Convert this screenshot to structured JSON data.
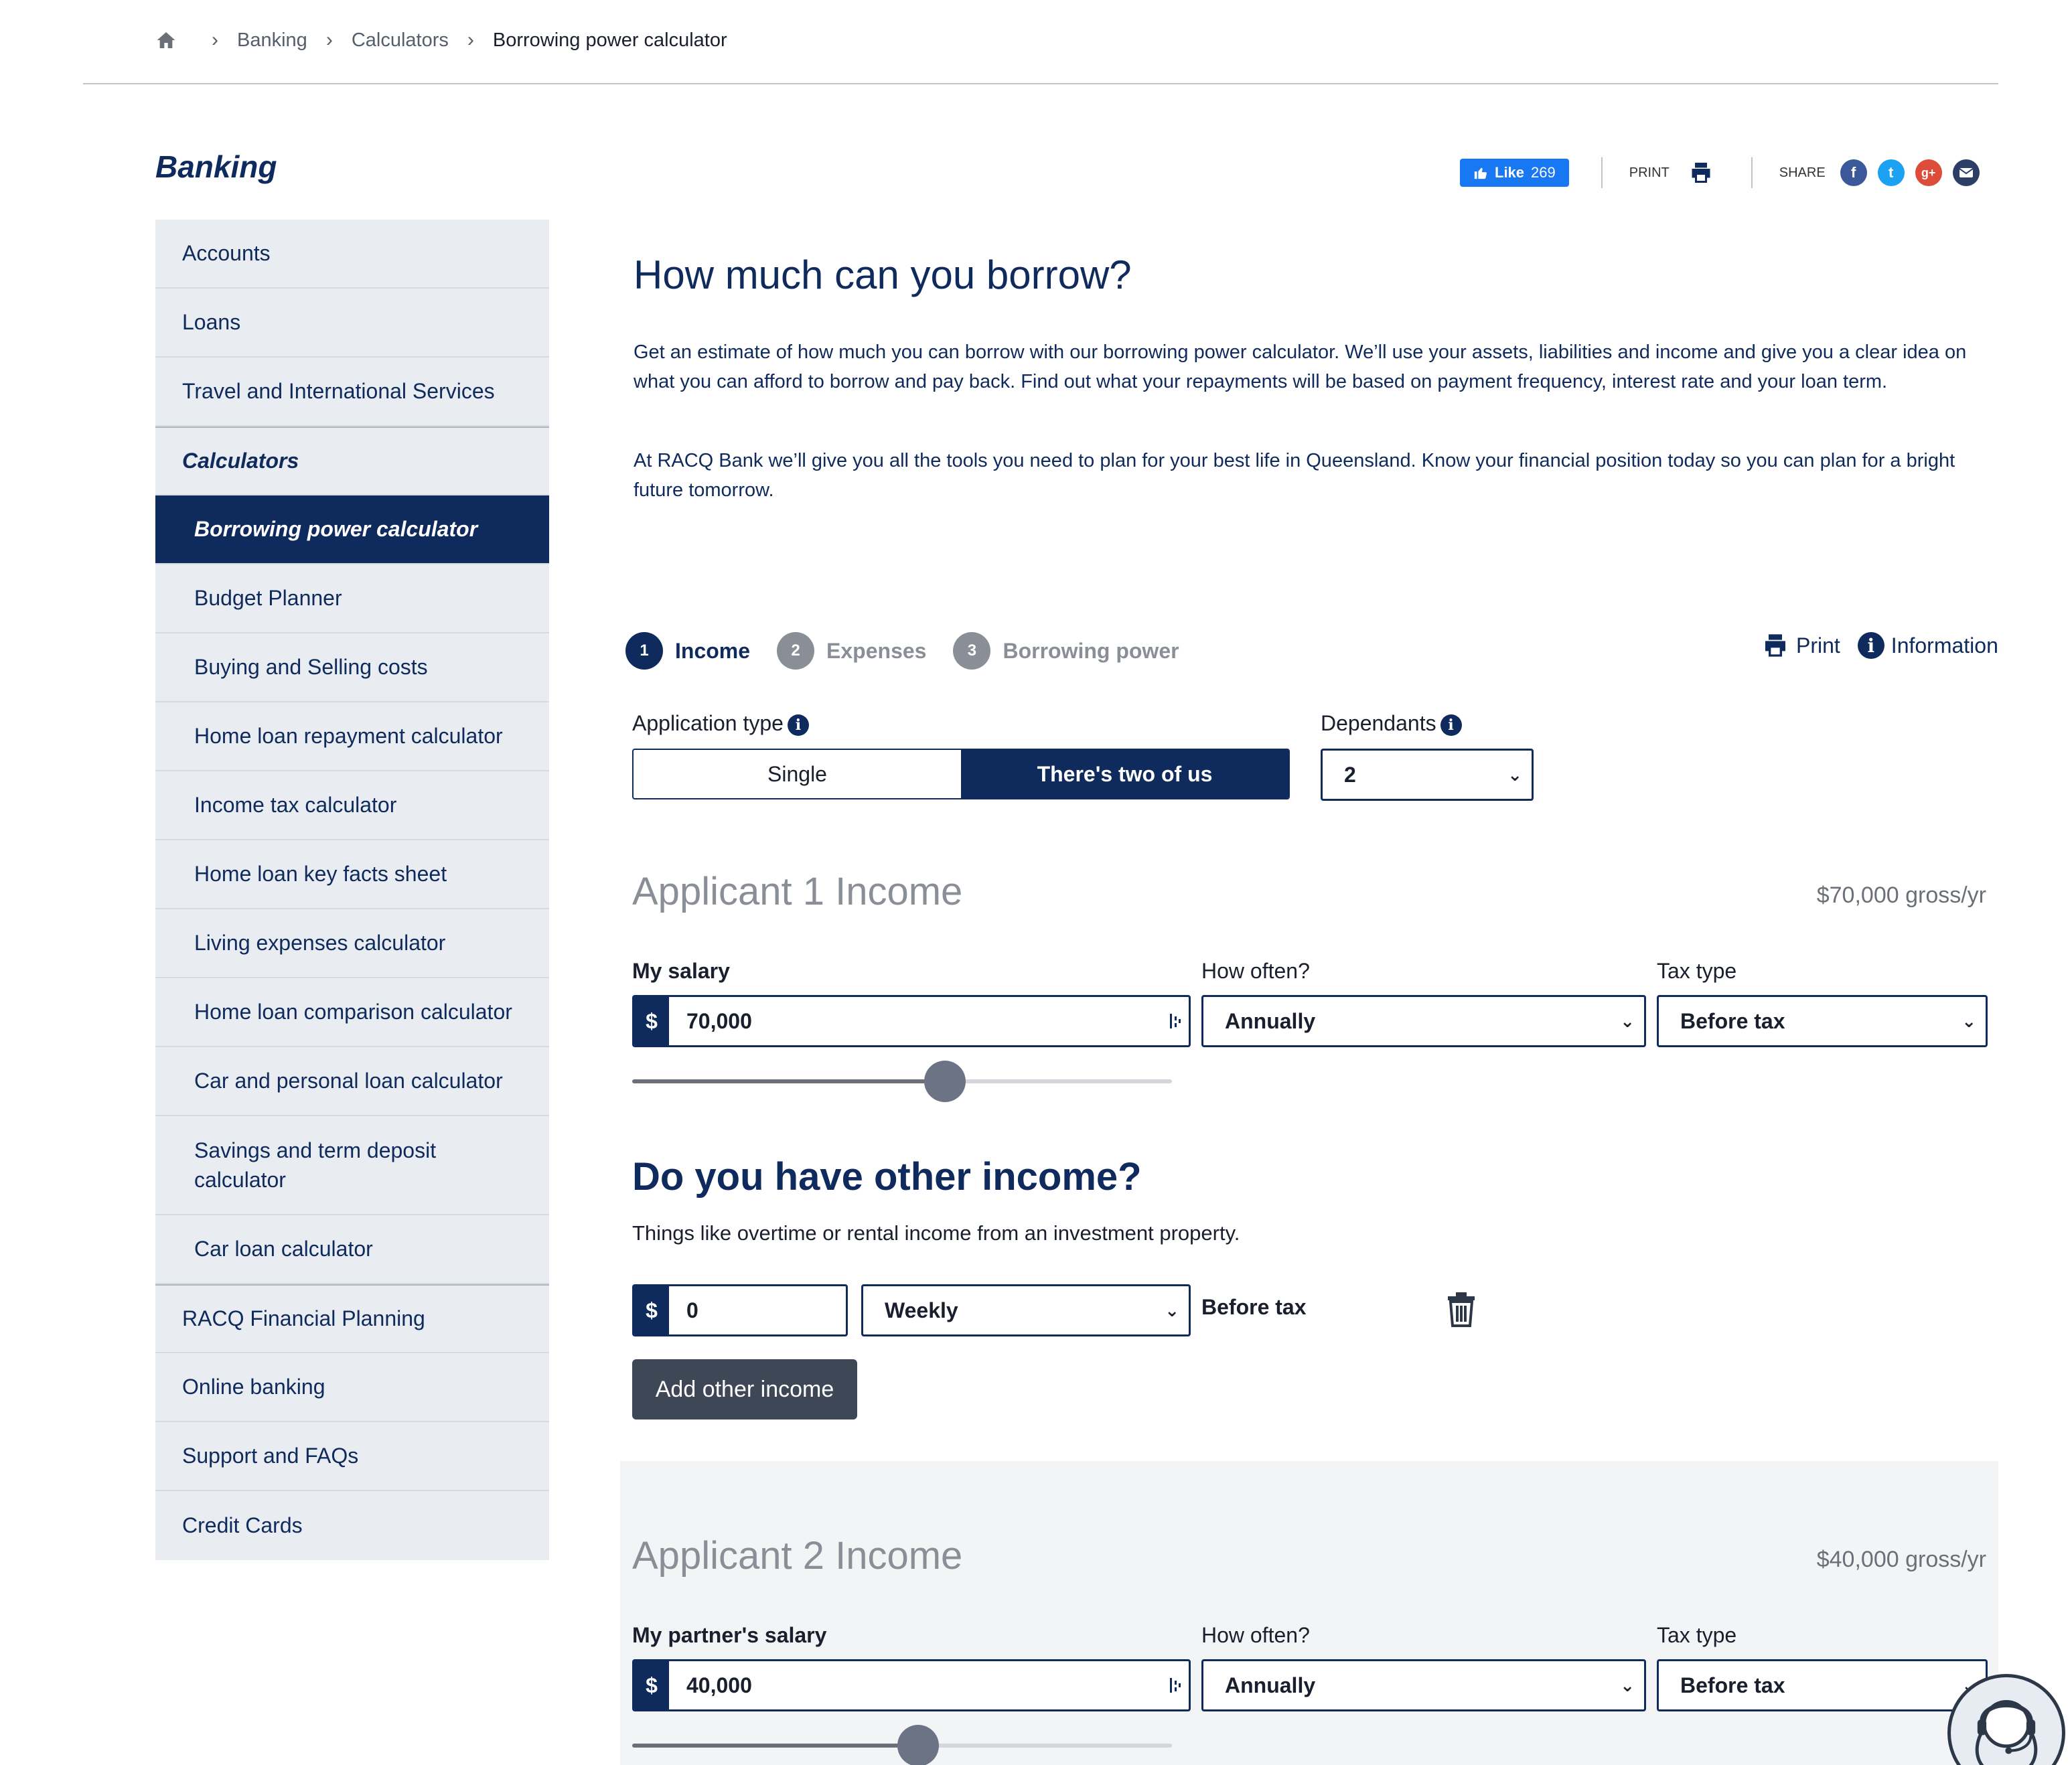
{
  "breadcrumb": {
    "items": [
      "Banking",
      "Calculators",
      "Borrowing power calculator"
    ]
  },
  "sidebar": {
    "title": "Banking",
    "items": [
      {
        "label": "Accounts"
      },
      {
        "label": "Loans"
      },
      {
        "label": "Travel and International Services"
      },
      {
        "label": "Calculators"
      },
      {
        "label": "Borrowing power calculator"
      },
      {
        "label": "Budget Planner"
      },
      {
        "label": "Buying and Selling costs"
      },
      {
        "label": "Home loan repayment calculator"
      },
      {
        "label": "Income tax calculator"
      },
      {
        "label": "Home loan key facts sheet"
      },
      {
        "label": "Living expenses calculator"
      },
      {
        "label": "Home loan comparison calculator"
      },
      {
        "label": "Car and personal loan calculator"
      },
      {
        "label": "Savings and term deposit calculator"
      },
      {
        "label": "Car loan calculator"
      },
      {
        "label": "RACQ Financial Planning"
      },
      {
        "label": "Online banking"
      },
      {
        "label": "Support and FAQs"
      },
      {
        "label": "Credit Cards"
      }
    ]
  },
  "share_bar": {
    "like_label": "Like",
    "like_count": "269",
    "print_label": "PRINT",
    "share_label": "SHARE"
  },
  "intro": {
    "title": "How much can you borrow?",
    "paragraph1": "Get an estimate of how much you can borrow with our borrowing power calculator. We’ll use your assets, liabilities and income and give you a clear idea on what you can afford to borrow and pay back. Find out what your repayments will be based on payment frequency, interest rate and your loan term.",
    "paragraph2": "At RACQ Bank we’ll give you all the tools you need to plan for your best life in Queensland. Know your financial position today so you can plan for a bright future tomorrow."
  },
  "steps": [
    {
      "num": "1",
      "label": "Income"
    },
    {
      "num": "2",
      "label": "Expenses"
    },
    {
      "num": "3",
      "label": "Borrowing power"
    }
  ],
  "tools": {
    "print_label": "Print",
    "info_label": "Information"
  },
  "application_type": {
    "label": "Application type",
    "options": [
      "Single",
      "There's two of us"
    ],
    "selected": "There's two of us"
  },
  "dependants": {
    "label": "Dependants",
    "value": "2"
  },
  "applicant1": {
    "title": "Applicant 1 Income",
    "gross": "$70,000 gross/yr",
    "salary_label": "My salary",
    "currency": "$",
    "salary_value": "70,000",
    "how_often_label": "How often?",
    "how_often_value": "Annually",
    "tax_type_label": "Tax type",
    "tax_type_value": "Before tax",
    "slider_fraction": 0.58
  },
  "other_income": {
    "title": "Do you have other income?",
    "description": "Things like overtime or rental income from an investment property.",
    "currency": "$",
    "amount": "0",
    "frequency": "Weekly",
    "tax_label": "Before tax",
    "add_button": "Add other income"
  },
  "applicant2": {
    "title": "Applicant 2 Income",
    "gross": "$40,000 gross/yr",
    "salary_label": "My partner's salary",
    "currency": "$",
    "salary_value": "40,000",
    "how_often_label": "How often?",
    "how_often_value": "Annually",
    "tax_type_label": "Tax type",
    "tax_type_value": "Before tax",
    "slider_fraction": 0.53
  },
  "colors": {
    "brand_navy": "#0f2a5c",
    "muted_gray": "#8a8f97",
    "sidebar_bg": "#e9ecf0",
    "button_dark": "#3e4756",
    "facebook": "#3b5998",
    "twitter": "#1da1f2",
    "google": "#dd4b39"
  }
}
